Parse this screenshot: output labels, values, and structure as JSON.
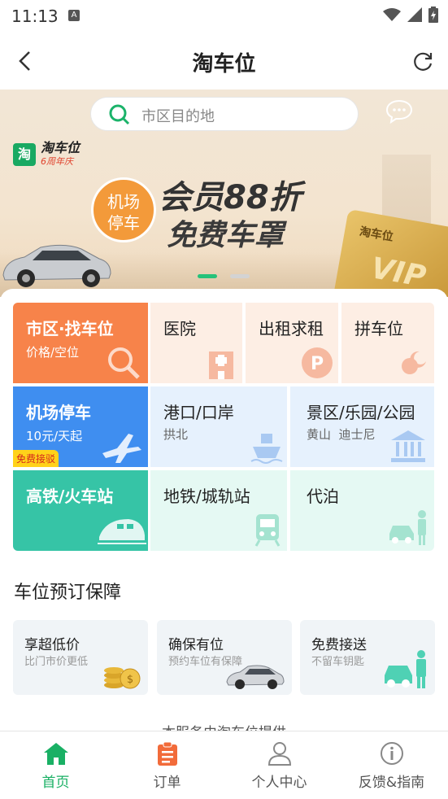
{
  "status": {
    "time": "11:13",
    "notif_icon": "A"
  },
  "header": {
    "title": "淘车位"
  },
  "search": {
    "placeholder": "市区目的地"
  },
  "banner": {
    "brand_name": "淘车位",
    "brand_sub": "6周年庆",
    "brand_logo": "淘",
    "airport_badge_line1": "机场",
    "airport_badge_line2": "停车",
    "promo_line1": "会员88折",
    "promo_line2": "免费车罩",
    "card_brand": "淘车位",
    "card_vip": "VIP"
  },
  "grid": {
    "city": {
      "title": "市区·找车位",
      "sub": "价格/空位"
    },
    "hospital": {
      "title": "医院"
    },
    "rent": {
      "title": "出租求租"
    },
    "share": {
      "title": "拼车位"
    },
    "airport": {
      "title": "机场停车",
      "sub": "10元/天起",
      "tag": "免费接驳"
    },
    "port": {
      "title": "港口/口岸",
      "sub": "拱北"
    },
    "scenic": {
      "title": "景区/乐园/公园",
      "sub": "黄山  迪士尼"
    },
    "rail": {
      "title": "高铁/火车站"
    },
    "metro": {
      "title": "地铁/城轨站"
    },
    "valet": {
      "title": "代泊"
    }
  },
  "guarantee": {
    "title": "车位预订保障",
    "items": [
      {
        "title": "享超低价",
        "sub": "比门市价更低"
      },
      {
        "title": "确保有位",
        "sub": "预约车位有保障"
      },
      {
        "title": "免费接送",
        "sub": "不留车钥匙"
      }
    ],
    "footer_note": "本服务由淘车位提供"
  },
  "tabs": [
    {
      "label": "首页",
      "icon": "home-icon"
    },
    {
      "label": "订单",
      "icon": "order-icon"
    },
    {
      "label": "个人中心",
      "icon": "user-icon"
    },
    {
      "label": "反馈&指南",
      "icon": "info-icon"
    }
  ],
  "colors": {
    "accent": "#19b064",
    "orange": "#f7834a",
    "blue": "#3f8ef0",
    "teal": "#36c4a6"
  }
}
